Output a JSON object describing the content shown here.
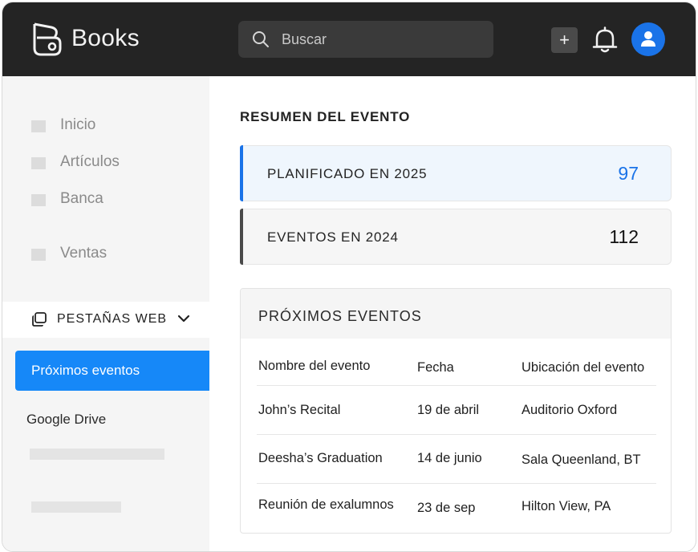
{
  "app": {
    "name": "Books"
  },
  "search": {
    "placeholder": "Buscar"
  },
  "header": {
    "add_label": "+"
  },
  "sidebar": {
    "items": [
      {
        "label": "Inicio"
      },
      {
        "label": "Artículos"
      },
      {
        "label": "Banca"
      },
      {
        "label": "Ventas"
      }
    ],
    "web_tabs_label": "PESTAÑAS WEB",
    "active_item": "Próximos eventos",
    "google_drive": "Google Drive"
  },
  "main": {
    "title": "RESUMEN DEL EVENTO",
    "stats": [
      {
        "label": "PLANIFICADO EN 2025",
        "value": "97",
        "color": "#1a73e8",
        "bar_color": "#1a73e8"
      },
      {
        "label": "EVENTOS EN 2024",
        "value": "112",
        "color": "#111111",
        "bar_color": "#4a4a4a"
      }
    ],
    "events": {
      "title": "PRÓXIMOS EVENTOS",
      "columns": [
        "Nombre del evento",
        "Fecha",
        "Ubicación del evento"
      ],
      "rows": [
        [
          "John’s Recital",
          "19 de abril",
          "Auditorio Oxford"
        ],
        [
          "Deesha’s Graduation",
          "14 de junio",
          "Sala Queenland, BT"
        ],
        [
          "Reunión de exalumnos",
          "23 de sep",
          "Hilton View, PA"
        ]
      ]
    }
  },
  "colors": {
    "header_bg": "#242424",
    "accent": "#1688f8",
    "avatar": "#1a73e8"
  }
}
